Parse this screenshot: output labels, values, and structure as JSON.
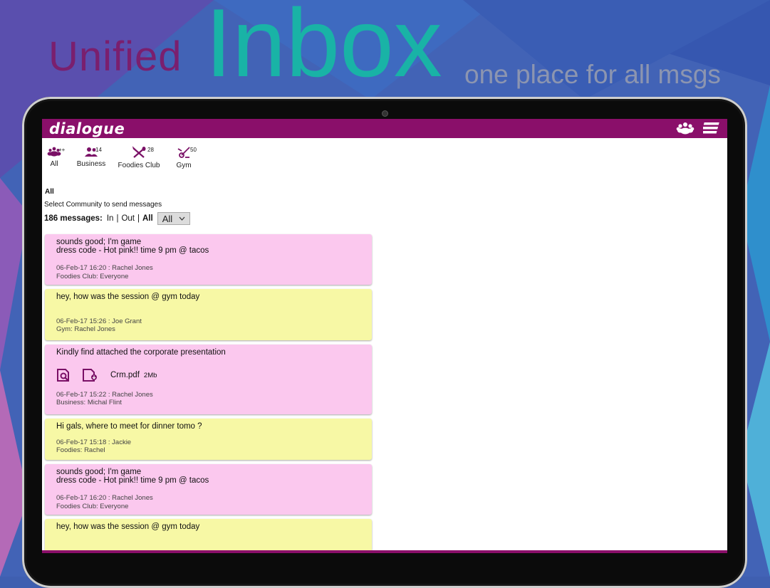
{
  "hero": {
    "word1": "Unified",
    "word2": "Inbox",
    "tagline": "one place for all msgs"
  },
  "app": {
    "logo": "dialogue",
    "brand_color": "#8a0f6a"
  },
  "tabs": [
    {
      "label": "All",
      "count": "++",
      "icon": "community-icon"
    },
    {
      "label": "Business",
      "count": "14",
      "icon": "business-people-icon"
    },
    {
      "label": "Foodies Club",
      "count": "28",
      "icon": "fork-knife-icon"
    },
    {
      "label": "Gym",
      "count": "50",
      "icon": "exercise-bike-icon"
    }
  ],
  "current_tab": "All",
  "hint": "Select Community to send messages",
  "filter": {
    "count_label": "186 messages:",
    "in": "In",
    "out": "Out",
    "all": "All",
    "select_value": "All"
  },
  "messages": [
    {
      "color": "pink",
      "text": "sounds good; I'm game\ndress code - Hot pink!! time 9 pm @ tacos",
      "meta1": "06-Feb-17  16:20 : Rachel Jones",
      "meta2": "Foodies Club: Everyone"
    },
    {
      "color": "yellow",
      "text": "hey, how was the session @ gym today",
      "meta1": "06-Feb-17  15:26 : Joe Grant",
      "meta2": "Gym: Rachel Jones"
    },
    {
      "color": "pink",
      "text": "Kindly find attached the corporate presentation",
      "file": "Crm.pdf",
      "size": "2Mb",
      "meta1": "06-Feb-17  15:22 : Rachel Jones",
      "meta2": "Business: Michal Flint"
    },
    {
      "color": "yellow",
      "text": "Hi gals, where to meet for dinner tomo ?",
      "meta1": "06-Feb-17  15:18 : Jackie",
      "meta2": "Foodies: Rachel"
    },
    {
      "color": "pink",
      "text": "sounds good; I'm game\ndress code - Hot pink!! time 9 pm @ tacos",
      "meta1": "06-Feb-17  16:20 : Rachel Jones",
      "meta2": "Foodies Club: Everyone"
    },
    {
      "color": "yellow",
      "text": "hey, how was the session @ gym today"
    }
  ]
}
